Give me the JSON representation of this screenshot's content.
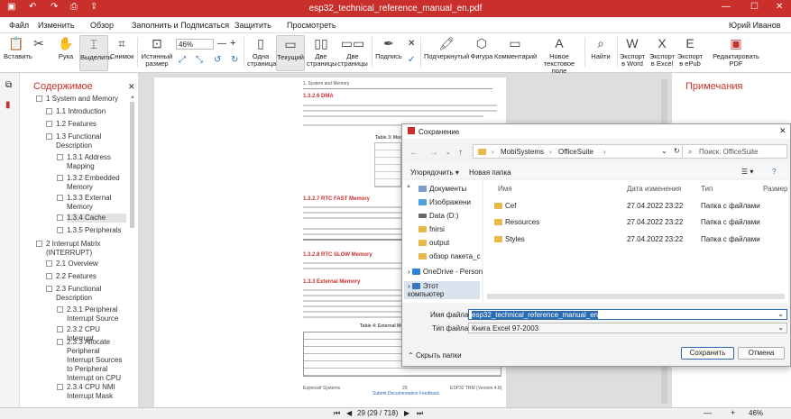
{
  "titlebar": {
    "title": "esp32_technical_reference_manual_en.pdf"
  },
  "menubar": {
    "items": [
      "Файл",
      "Изменить",
      "Обзор",
      "Заполнить и Подписаться",
      "Защитить",
      "Просмотреть"
    ],
    "user": "Юрий Иванов"
  },
  "ribbon": {
    "paste": "Вставить",
    "hand": "Рука",
    "select": "Выделить",
    "snapshot": "Снимок",
    "actual_size": "Истинный размер",
    "zoom": "46%",
    "single_page": "Одна страница",
    "current": "Текущий",
    "two_pages": "Две страницы",
    "two_pages2": "Две страницы",
    "sign": "Подпись",
    "highlight": "Подчеркнутый",
    "shape": "Фигура",
    "comment": "Комментарий",
    "text_field": "Новое текстовое поле",
    "find": "Найти",
    "export_word": "Экспорт в Word",
    "export_excel": "Экспорт в Excel",
    "export_epub": "Экспорт в ePub",
    "edit_pdf": "Редактировать PDF"
  },
  "toc": {
    "title": "Содержимое",
    "items": [
      {
        "label": "1 System and Memory"
      },
      {
        "label": "1.1 Introduction"
      },
      {
        "label": "1.2 Features"
      },
      {
        "label": "1.3 Functional Description"
      },
      {
        "label": "1.3.1 Address Mapping"
      },
      {
        "label": "1.3.2 Embedded Memory"
      },
      {
        "label": "1.3.3 External Memory"
      },
      {
        "label": "1.3.4 Cache"
      },
      {
        "label": "1.3.5 Peripherals"
      },
      {
        "label": "2 Interrupt Matrix (INTERRUPT)"
      },
      {
        "label": "2.1 Overview"
      },
      {
        "label": "2.2 Features"
      },
      {
        "label": "2.3 Functional Description"
      },
      {
        "label": "2.3.1 Peripheral Interrupt Source"
      },
      {
        "label": "2.3.2 CPU Interrupt"
      },
      {
        "label": "2.3.3 Allocate Peripheral Interrupt Sources to Peripheral Interrupt on CPU"
      },
      {
        "label": "2.3.4 CPU NMI Interrupt Mask"
      }
    ]
  },
  "notes": {
    "title": "Примечания"
  },
  "page": {
    "header": "1. System and Memory",
    "h1": "1.3.2.6 DMA",
    "h2": "1.3.2.7 RTC FAST Memory",
    "h3": "1.3.2.8 RTC SLOW Memory",
    "h4": "1.3.3 External Memory",
    "footer_left": "Espressif Systems",
    "footer_mid": "29",
    "footer_right": "ESP32 TRM (Version 4.8)",
    "footer_link": "Submit Documentation Feedback",
    "table_title": "Table 3: Module",
    "table4_title": "Table 4: External Mem"
  },
  "dialog": {
    "title": "Сохранение",
    "path_1": "MobiSystems",
    "path_2": "OfficeSuite",
    "search_placeholder": "Поиск: OfficeSuite",
    "organize": "Упорядочить",
    "new_folder": "Новая папка",
    "nav": [
      "Документы",
      "Изображени",
      "Data (D:)",
      "fnirsi",
      "output",
      "обзор пакета_с",
      "OneDrive - Person",
      "Этот компьютер"
    ],
    "columns": [
      "Имя",
      "Дата изменения",
      "Тип",
      "Размер"
    ],
    "files": [
      {
        "name": "Cef",
        "date": "27.04.2022 23:22",
        "type": "Папка с файлами"
      },
      {
        "name": "Resources",
        "date": "27.04.2022 23:22",
        "type": "Папка с файлами"
      },
      {
        "name": "Styles",
        "date": "27.04.2022 23:22",
        "type": "Папка с файлами"
      }
    ],
    "filename_label": "Имя файла:",
    "filename_value": "esp32_technical_reference_manual_en",
    "filetype_label": "Тип файла:",
    "filetype_value": "Книга Excel 97-2003",
    "hide_folders": "Скрыть папки",
    "save": "Сохранить",
    "cancel": "Отмена"
  },
  "status": {
    "page": "29 (29 / 718)",
    "zoom": "46%"
  }
}
